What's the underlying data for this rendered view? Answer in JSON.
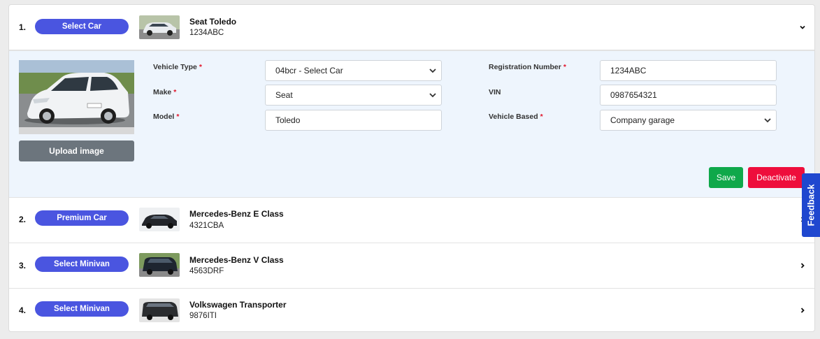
{
  "vehicles": [
    {
      "index": "1.",
      "badge": "Select Car",
      "name": "Seat Toledo",
      "plate": "1234ABC",
      "expanded": true
    },
    {
      "index": "2.",
      "badge": "Premium Car",
      "name": "Mercedes-Benz E Class",
      "plate": "4321CBA",
      "expanded": false
    },
    {
      "index": "3.",
      "badge": "Select Minivan",
      "name": "Mercedes-Benz V Class",
      "plate": "4563DRF",
      "expanded": false
    },
    {
      "index": "4.",
      "badge": "Select Minivan",
      "name": "Volkswagen Transporter",
      "plate": "9876ITI",
      "expanded": false
    }
  ],
  "detail": {
    "upload_label": "Upload image",
    "required_mark": "*",
    "vehicle_type": {
      "label": "Vehicle Type",
      "value": "04bcr - Select Car"
    },
    "make": {
      "label": "Make",
      "value": "Seat"
    },
    "model": {
      "label": "Model",
      "value": "Toledo"
    },
    "registration": {
      "label": "Registration Number",
      "value": "1234ABC"
    },
    "vin": {
      "label": "VIN",
      "value": "0987654321"
    },
    "vehicle_based": {
      "label": "Vehicle Based",
      "value": "Company garage"
    },
    "save_label": "Save",
    "deactivate_label": "Deactivate"
  },
  "feedback_label": "Feedback",
  "colors": {
    "badge": "#4a55e0",
    "save": "#0fa84a",
    "deactivate": "#ee0e3c",
    "upload": "#6c757d",
    "feedback": "#1f47cf",
    "detail_bg": "#eef5fd"
  },
  "icons": {
    "expanded": "chevron-down-icon",
    "collapsed": "chevron-right-icon"
  }
}
